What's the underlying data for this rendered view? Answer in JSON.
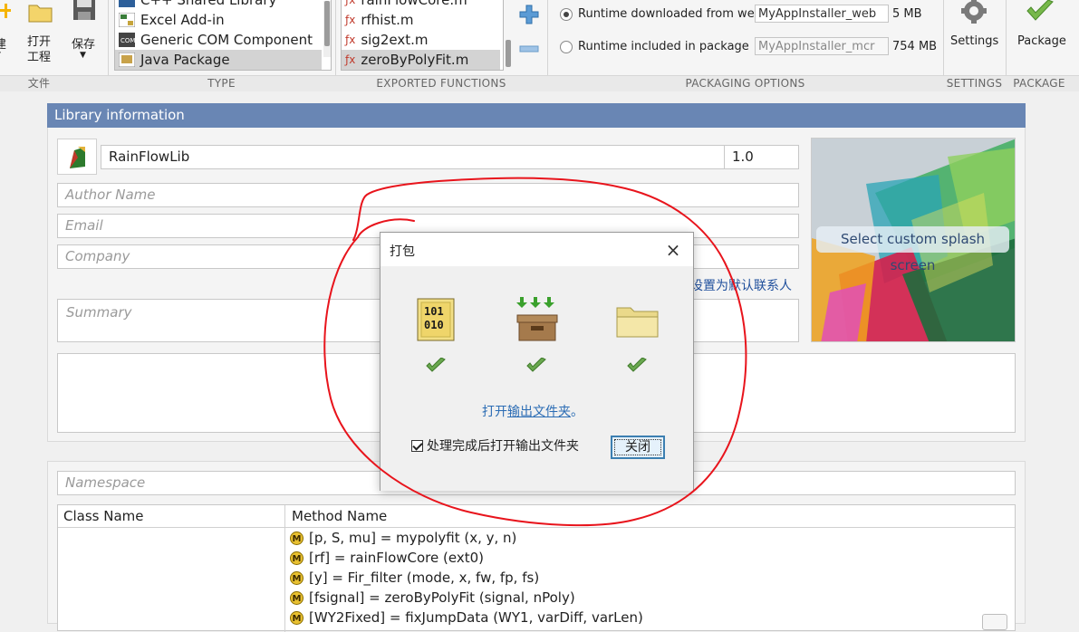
{
  "toolbar": {
    "partial_new": "建",
    "open_project": "打开\n工程",
    "save": "保存",
    "type_items": [
      {
        "label": "C++ Shared Library",
        "selected": false
      },
      {
        "label": "Excel Add-in",
        "selected": false
      },
      {
        "label": "Generic COM Component",
        "selected": false
      },
      {
        "label": "Java Package",
        "selected": true
      }
    ],
    "function_items": [
      {
        "label": "rainFlowCore.m",
        "selected": false
      },
      {
        "label": "rfhist.m",
        "selected": false
      },
      {
        "label": "sig2ext.m",
        "selected": false
      },
      {
        "label": "zeroByPolyFit.m",
        "selected": true
      }
    ],
    "packaging": {
      "web_label": "Runtime downloaded from web",
      "web_value": "MyAppInstaller_web",
      "web_size": "5 MB",
      "mcr_label": "Runtime included in package",
      "mcr_value": "MyAppInstaller_mcr",
      "mcr_size": "754 MB"
    },
    "settings_label": "Settings",
    "package_label": "Package",
    "sections": {
      "file": "文件",
      "type": "TYPE",
      "exported": "EXPORTED FUNCTIONS",
      "packaging": "PACKAGING OPTIONS",
      "settings": "SETTINGS",
      "package": "PACKAGE"
    }
  },
  "library": {
    "header": "Library information",
    "name": "RainFlowLib",
    "version": "1.0",
    "author_placeholder": "Author Name",
    "email_placeholder": "Email",
    "company_placeholder": "Company",
    "summary_placeholder": "Summary",
    "set_default_contact": "设置为默认联系人",
    "splash_button": "Select custom splash screen"
  },
  "namespace": {
    "placeholder": "Namespace",
    "col_class": "Class Name",
    "col_method": "Method Name",
    "methods": [
      "[p, S, mu] = mypolyfit (x, y, n)",
      "[rf] = rainFlowCore (ext0)",
      "[y] = Fir_filter (mode, x, fw, fp, fs)",
      "[fsignal] = zeroByPolyFit (signal, nPoly)",
      "[WY2Fixed] = fixJumpData (WY1, varDiff, varLen)"
    ]
  },
  "dialog": {
    "title": "打包",
    "close_icon": "×",
    "link_prefix": "打开",
    "link_text": "输出文件夹",
    "link_suffix": "。",
    "checkbox_label": "处理完成后打开输出文件夹",
    "checkbox_checked": true,
    "close_button": "关闭"
  },
  "colors": {
    "panel_header": "#6986b4",
    "link": "#2b6cb4",
    "annotation": "#e8141c",
    "check": "#5a9e3a"
  }
}
